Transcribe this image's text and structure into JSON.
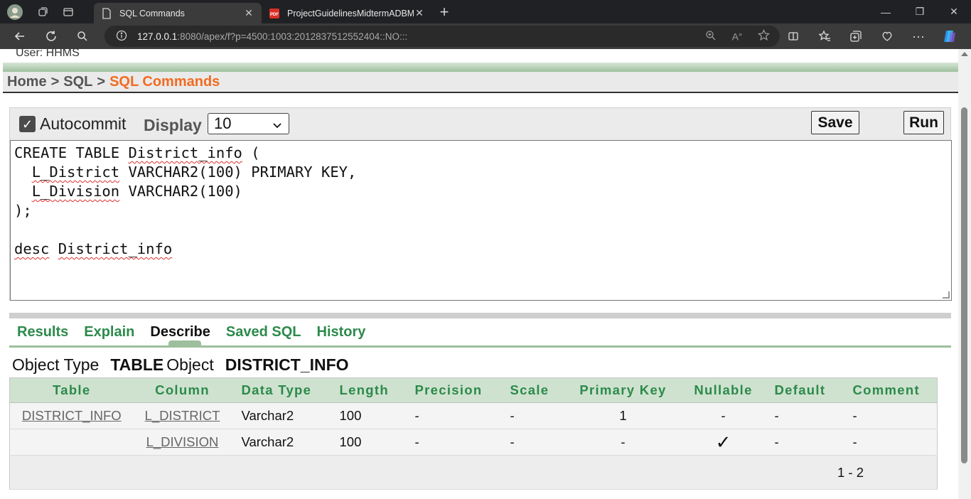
{
  "browser": {
    "tabs": [
      {
        "title": "SQL Commands",
        "active": true,
        "icon": "page-icon"
      },
      {
        "title": "ProjectGuidelinesMidtermADBMS",
        "active": false,
        "icon": "pdf-icon"
      }
    ],
    "url_host": "127.0.0.1",
    "url_rest": ":8080/apex/f?p=4500:1003:2012837512552404::NO:::"
  },
  "page": {
    "user_line": "User: HHMS",
    "breadcrumb": {
      "home": "Home",
      "sql": "SQL",
      "current": "SQL Commands",
      "sep": ">"
    },
    "toolbar": {
      "autocommit_label": "Autocommit",
      "autocommit_checked": true,
      "display_label": "Display",
      "display_value": "10",
      "save_label": "Save",
      "run_label": "Run"
    },
    "editor_lines": [
      "CREATE TABLE District_info (",
      "  L_District VARCHAR2(100) PRIMARY KEY,",
      "  L_Division VARCHAR2(100)",
      ");",
      "",
      "desc District_info"
    ],
    "result_tabs": [
      "Results",
      "Explain",
      "Describe",
      "Saved SQL",
      "History"
    ],
    "active_tab": "Describe",
    "object_type_label": "Object Type",
    "object_type_value": "TABLE",
    "object_label": "Object",
    "object_value": "DISTRICT_INFO",
    "table": {
      "headers": [
        "Table",
        "Column",
        "Data Type",
        "Length",
        "Precision",
        "Scale",
        "Primary Key",
        "Nullable",
        "Default",
        "Comment"
      ],
      "rows": [
        {
          "table": "DISTRICT_INFO",
          "column": "L_DISTRICT",
          "data_type": "Varchar2",
          "length": "100",
          "precision": "-",
          "scale": "-",
          "primary_key": "1",
          "nullable": "-",
          "default": "-",
          "comment": "-"
        },
        {
          "table": "",
          "column": "L_DIVISION",
          "data_type": "Varchar2",
          "length": "100",
          "precision": "-",
          "scale": "-",
          "primary_key": "-",
          "nullable": "✓",
          "default": "-",
          "comment": "-"
        }
      ],
      "pagination": "1 - 2"
    }
  },
  "colors": {
    "accent_orange": "#f26b21",
    "tab_green": "#2c8a4b",
    "header_green": "#cfe2cf"
  }
}
